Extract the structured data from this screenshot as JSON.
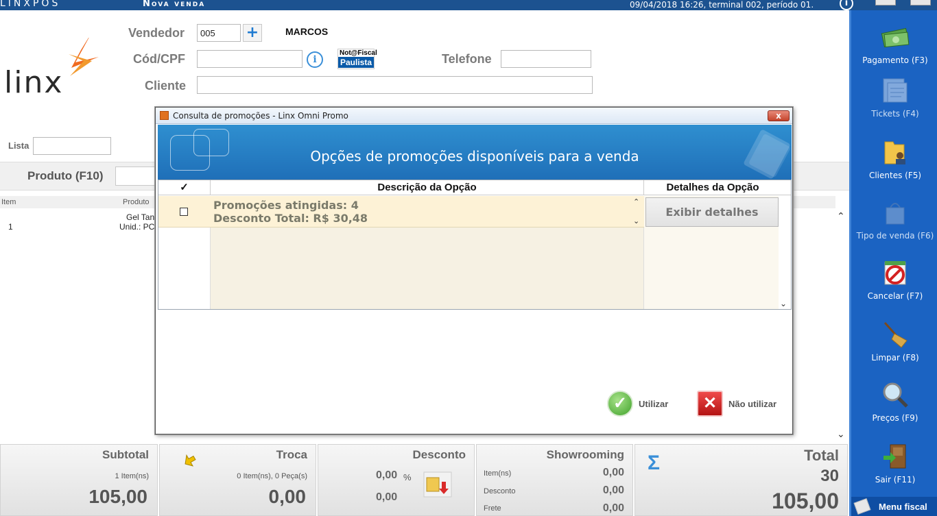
{
  "topbar": {
    "app_name": "LINXPOS",
    "window_title": "Nova venda",
    "status": "09/04/2018 16:26, terminal 002, período 01."
  },
  "header": {
    "logo_text": "linx",
    "vendedor_label": "Vendedor",
    "vendedor_code": "005",
    "vendedor_name": "MARCOS",
    "cpf_label": "Cód/CPF",
    "cpf_value": "",
    "nota_fiscal_badge_top": "Not@Fiscal",
    "nota_fiscal_badge_bottom": "Paulista",
    "telefone_label": "Telefone",
    "telefone_value": "",
    "cliente_label": "Cliente",
    "cliente_value": "",
    "lista_label": "Lista",
    "lista_value": ""
  },
  "product": {
    "label": "Produto (F10)",
    "value": ""
  },
  "items_grid": {
    "columns": [
      "Item",
      "Produto"
    ],
    "rows": [
      {
        "item": "1",
        "produto_line1": "Gel Tan",
        "produto_line2": "Unid.: PC"
      }
    ]
  },
  "sidebar": {
    "items": [
      {
        "label": "Pagamento (F3)",
        "icon": "money-icon",
        "enabled": true
      },
      {
        "label": "Tickets (F4)",
        "icon": "tickets-icon",
        "enabled": false
      },
      {
        "label": "Clientes (F5)",
        "icon": "clients-folder-icon",
        "enabled": true
      },
      {
        "label": "Tipo de venda (F6)",
        "icon": "shopping-bag-icon",
        "enabled": false
      },
      {
        "label": "Cancelar (F7)",
        "icon": "cancel-icon",
        "enabled": true
      },
      {
        "label": "Limpar (F8)",
        "icon": "broom-icon",
        "enabled": true
      },
      {
        "label": "Preços (F9)",
        "icon": "magnifier-icon",
        "enabled": true
      },
      {
        "label": "Sair (F11)",
        "icon": "exit-door-icon",
        "enabled": true
      }
    ],
    "menu_fiscal": "Menu fiscal"
  },
  "totals": {
    "subtotal": {
      "title": "Subtotal",
      "items": "1 Item(ns)",
      "value": "105,00"
    },
    "troca": {
      "title": "Troca",
      "items": "0 Item(ns), 0 Peça(s)",
      "value": "0,00"
    },
    "desconto": {
      "title": "Desconto",
      "percent": "0,00",
      "percent_sign": "%",
      "value": "0,00"
    },
    "showrooming": {
      "title": "Showrooming",
      "rows": [
        {
          "label": "Item(ns)",
          "value": "0,00"
        },
        {
          "label": "Desconto",
          "value": "0,00"
        },
        {
          "label": "Frete",
          "value": "0,00"
        }
      ]
    },
    "total": {
      "title": "Total",
      "count": "30",
      "value": "105,00"
    }
  },
  "dialog": {
    "window_title": "Consulta de promoções - Linx Omni Promo",
    "close_label": "x",
    "banner_title": "Opções de promoções disponíveis para a venda",
    "columns": {
      "check": "✓",
      "description": "Descrição da Opção",
      "details": "Detalhes da Opção"
    },
    "options": [
      {
        "line1": "Promoções atingidas: 4",
        "line2": "Desconto Total: R$ 30,48",
        "checked": false,
        "details_button": "Exibir detalhes"
      }
    ],
    "use_button": "Utilizar",
    "dont_use_button": "Não utilizar"
  }
}
